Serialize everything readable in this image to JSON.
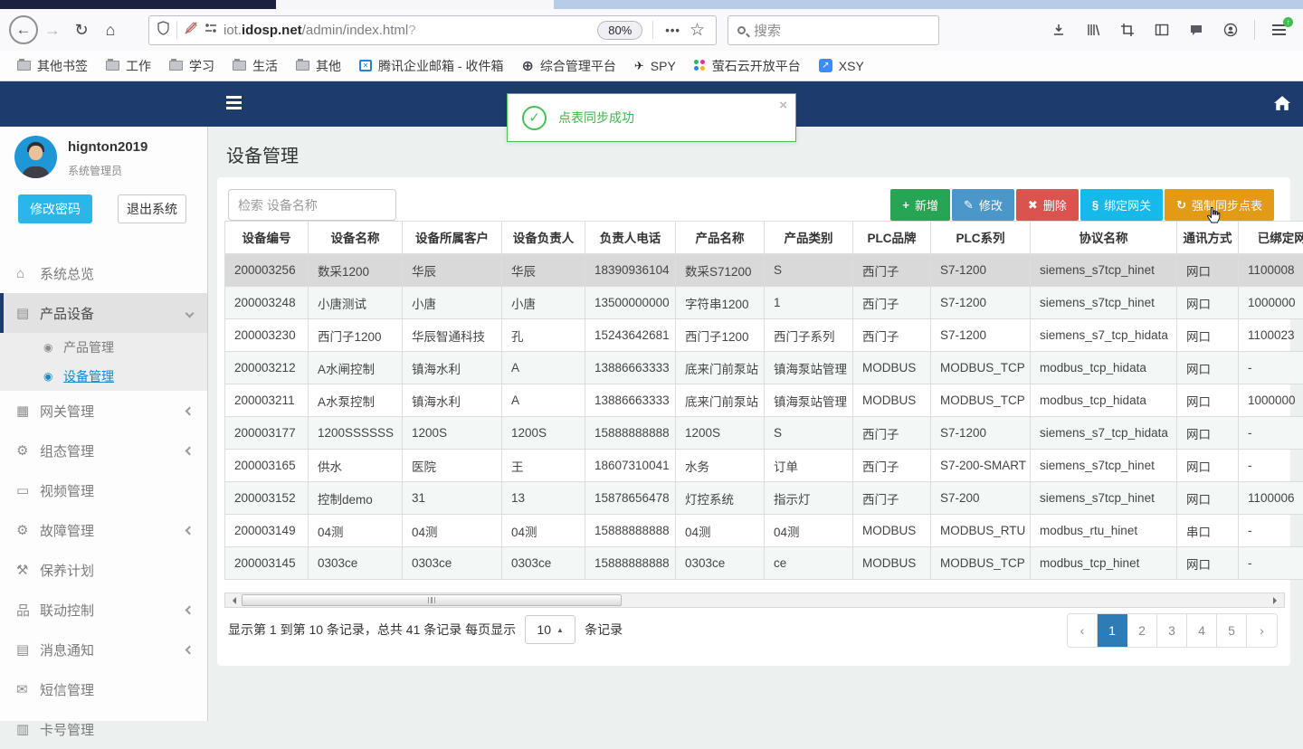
{
  "colors": {
    "header_navy": "#1d3b6d",
    "accent_blue": "#1b87c5",
    "btn_add_green": "#28a455",
    "btn_edit_blue": "#4b97c9",
    "btn_delete_red": "#d9534f",
    "btn_bind_cyan": "#16b9ea",
    "btn_sync_orange": "#e39a17",
    "pager_active": "#2e7cb5",
    "toast_green": "#43c153",
    "change_pwd_cyan": "#29b7e9"
  },
  "icon_glyphs": {
    "home": "⌂",
    "product": "▤",
    "target": "◉",
    "gateway": "▦",
    "gears": "⚙",
    "screen": "▭",
    "wrench": "⚒",
    "sitemap": "品",
    "book": "▤",
    "envelope": "✉",
    "card": "▥",
    "plus": "+",
    "pencil": "✎",
    "x": "✖",
    "link": "§",
    "refresh": "↻"
  },
  "browser": {
    "url": {
      "pre": "iot.",
      "domain": "idosp.net",
      "path": "/admin/index.html",
      "query": "?"
    },
    "zoom_badge": "80%",
    "more_dots": "•••",
    "star": "☆",
    "search_placeholder": "搜索",
    "bookmarks": [
      {
        "label": "其他书签",
        "icon": "folder"
      },
      {
        "label": "工作",
        "icon": "folder"
      },
      {
        "label": "学习",
        "icon": "folder"
      },
      {
        "label": "生活",
        "icon": "folder"
      },
      {
        "label": "其他",
        "icon": "folder"
      },
      {
        "label": "腾讯企业邮箱 - 收件箱",
        "icon": "exmail"
      },
      {
        "label": "综合管理平台",
        "icon": "globe"
      },
      {
        "label": "SPY",
        "icon": "jet"
      },
      {
        "label": "萤石云开放平台",
        "icon": "dots"
      },
      {
        "label": "XSY",
        "icon": "xsy"
      }
    ]
  },
  "app": {
    "toast": {
      "message": "点表同步成功",
      "close_label": "×"
    },
    "user": {
      "name": "hignton2019",
      "role": "系统管理员",
      "change_password_label": "修改密码",
      "logout_label": "退出系统"
    },
    "menu": [
      {
        "id": "overview",
        "label": "系统总览",
        "icon": "home"
      },
      {
        "id": "product-device",
        "label": "产品设备",
        "icon": "product",
        "arrow": "down",
        "active": true
      },
      {
        "id": "product-mgmt",
        "label": "产品管理",
        "icon": "target",
        "sub": true
      },
      {
        "id": "device-mgmt",
        "label": "设备管理",
        "icon": "target",
        "sub": true,
        "selected": true
      },
      {
        "id": "gateway-mgmt",
        "label": "网关管理",
        "icon": "gateway",
        "arrow": "left"
      },
      {
        "id": "scada-mgmt",
        "label": "组态管理",
        "icon": "gears",
        "arrow": "left"
      },
      {
        "id": "video-mgmt",
        "label": "视频管理",
        "icon": "screen"
      },
      {
        "id": "fault-mgmt",
        "label": "故障管理",
        "icon": "gears",
        "arrow": "left"
      },
      {
        "id": "maintenance-plan",
        "label": "保养计划",
        "icon": "wrench"
      },
      {
        "id": "linkage-control",
        "label": "联动控制",
        "icon": "sitemap",
        "arrow": "left"
      },
      {
        "id": "message-notify",
        "label": "消息通知",
        "icon": "book",
        "arrow": "left"
      },
      {
        "id": "sms-mgmt",
        "label": "短信管理",
        "icon": "envelope"
      },
      {
        "id": "card-mgmt",
        "label": "卡号管理",
        "icon": "card"
      }
    ],
    "page_title": "设备管理",
    "device_search_placeholder": "检索 设备名称",
    "actions": [
      {
        "id": "add",
        "label": "新增",
        "icon": "plus",
        "color": "#28a455"
      },
      {
        "id": "edit",
        "label": "修改",
        "icon": "pencil",
        "color": "#4b97c9"
      },
      {
        "id": "delete",
        "label": "删除",
        "icon": "x",
        "color": "#d9534f"
      },
      {
        "id": "bind-gateway",
        "label": "绑定网关",
        "icon": "link",
        "color": "#16b9ea"
      },
      {
        "id": "force-sync",
        "label": "强制同步点表",
        "icon": "refresh",
        "color": "#e39a17"
      }
    ],
    "table": {
      "headers": [
        "设备编号",
        "设备名称",
        "设备所属客户",
        "设备负责人",
        "负责人电话",
        "产品名称",
        "产品类别",
        "PLC品牌",
        "PLC系列",
        "协议名称",
        "通讯方式",
        "已绑定网关"
      ],
      "rows": [
        [
          "200003256",
          "数采1200",
          "华辰",
          "华辰",
          "18390936104",
          "数采S71200",
          "S",
          "西门子",
          "S7-1200",
          "siemens_s7tcp_hinet",
          "网口",
          "1100008"
        ],
        [
          "200003248",
          "小唐测试",
          "小唐",
          "小唐",
          "13500000000",
          "字符串1200",
          "1",
          "西门子",
          "S7-1200",
          "siemens_s7tcp_hinet",
          "网口",
          "1000000"
        ],
        [
          "200003230",
          "西门子1200",
          "华辰智通科技",
          "孔",
          "15243642681",
          "西门子1200",
          "西门子系列",
          "西门子",
          "S7-1200",
          "siemens_s7_tcp_hidata",
          "网口",
          "1100023"
        ],
        [
          "200003212",
          "A水闸控制",
          "镇海水利",
          "A",
          "13886663333",
          "底来门前泵站",
          "镇海泵站管理",
          "MODBUS",
          "MODBUS_TCP",
          "modbus_tcp_hidata",
          "网口",
          "-"
        ],
        [
          "200003211",
          "A水泵控制",
          "镇海水利",
          "A",
          "13886663333",
          "底来门前泵站",
          "镇海泵站管理",
          "MODBUS",
          "MODBUS_TCP",
          "modbus_tcp_hidata",
          "网口",
          "1000000"
        ],
        [
          "200003177",
          "1200SSSSSS",
          "1200S",
          "1200S",
          "15888888888",
          "1200S",
          "S",
          "西门子",
          "S7-1200",
          "siemens_s7_tcp_hidata",
          "网口",
          "-"
        ],
        [
          "200003165",
          "供水",
          "医院",
          "王",
          "18607310041",
          "水务",
          "订单",
          "西门子",
          "S7-200-SMART",
          "siemens_s7tcp_hinet",
          "网口",
          "-"
        ],
        [
          "200003152",
          "控制demo",
          "31",
          "13",
          "15878656478",
          "灯控系统",
          "指示灯",
          "西门子",
          "S7-200",
          "siemens_s7tcp_hinet",
          "网口",
          "1100006"
        ],
        [
          "200003149",
          "04测",
          "04测",
          "04测",
          "15888888888",
          "04测",
          "04测",
          "MODBUS",
          "MODBUS_RTU",
          "modbus_rtu_hinet",
          "串口",
          "-"
        ],
        [
          "200003145",
          "0303ce",
          "0303ce",
          "0303ce",
          "15888888888",
          "0303ce",
          "ce",
          "MODBUS",
          "MODBUS_TCP",
          "modbus_tcp_hinet",
          "网口",
          "-"
        ]
      ],
      "selected_row": 0
    },
    "pagination": {
      "info": "显示第 1 到第 10 条记录，总共 41 条记录 每页显示",
      "page_size": "10",
      "suffix": "条记录",
      "prev": "‹",
      "next": "›",
      "pages": [
        "1",
        "2",
        "3",
        "4",
        "5"
      ],
      "active_page": "1"
    }
  }
}
